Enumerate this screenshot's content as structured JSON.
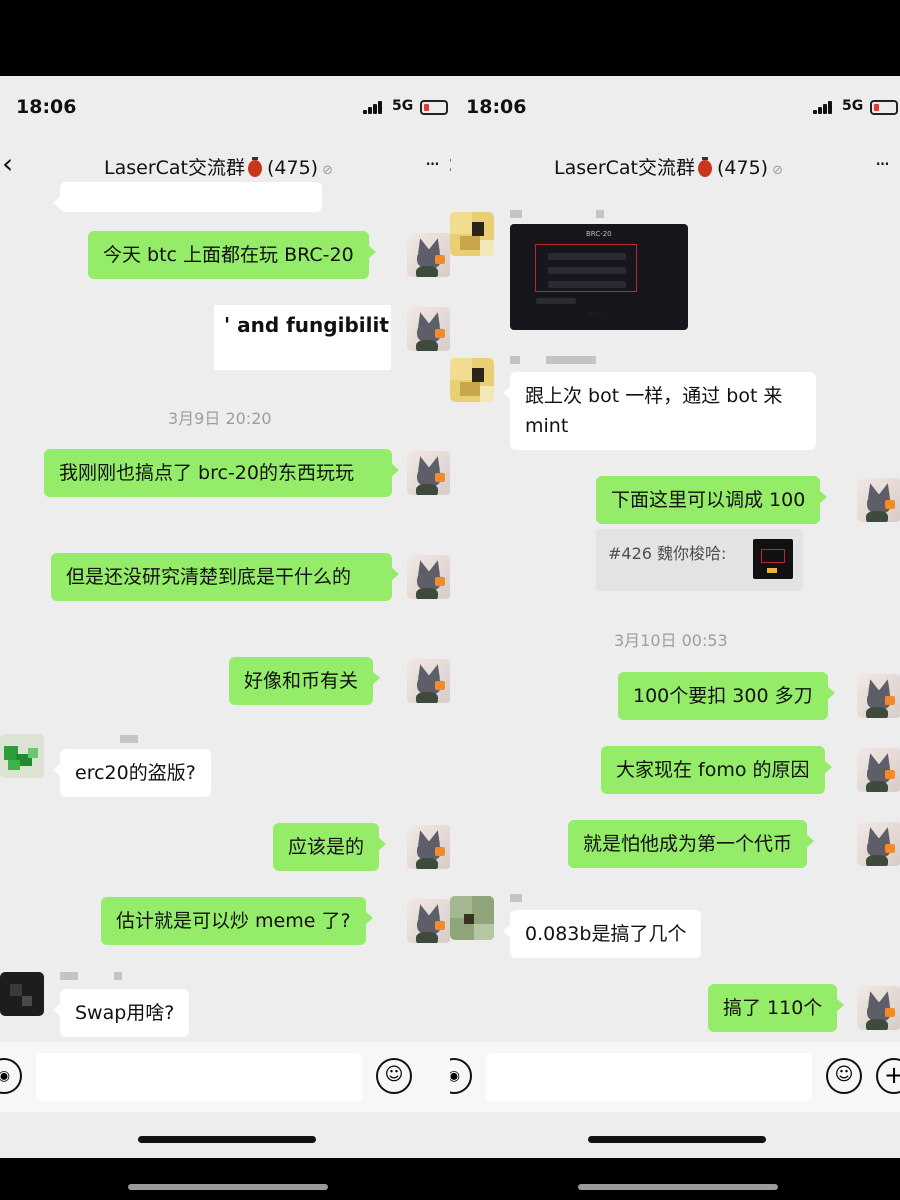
{
  "left": {
    "status": {
      "time": "18:06",
      "network": "5G"
    },
    "nav": {
      "back": "‹",
      "title": "LaserCat交流群",
      "count": "(475)",
      "mute": "⊘",
      "more": "···"
    },
    "messages": [
      {
        "text": "今天 btc 上面都在玩 BRC-20"
      },
      {
        "text": "' and fungibilit"
      },
      {
        "text": "我刚刚也搞点了 brc-20的东西玩玩"
      },
      {
        "text": "但是还没研究清楚到底是干什么的"
      },
      {
        "text": "好像和币有关"
      },
      {
        "text": "erc20的盗版?"
      },
      {
        "text": "应该是的"
      },
      {
        "text": "估计就是可以炒 meme 了?"
      },
      {
        "text": "Swap用啥?"
      }
    ],
    "timestamp": "3月9日 20:20"
  },
  "right": {
    "status": {
      "time": "18:06",
      "network": "5G"
    },
    "nav": {
      "back": "‹",
      "title": "LaserCat交流群",
      "count": "(475)",
      "mute": "⊘",
      "more": "···"
    },
    "mint_card": {
      "title": "BRC-20",
      "button": "Mint"
    },
    "messages": [
      {
        "text": "跟上次 bot 一样，通过 bot 来 mint"
      },
      {
        "text": "下面这里可以调成 100"
      },
      {
        "text": "100个要扣 300 多刀"
      },
      {
        "text": "大家现在 fomo 的原因"
      },
      {
        "text": "就是怕他成为第一个代币"
      },
      {
        "text": "0.083b是搞了几个"
      },
      {
        "text": "搞了 110个"
      }
    ],
    "quote": {
      "text": "#426 魏你梭哈:"
    },
    "timestamp": "3月10日 00:53"
  },
  "input": {
    "emoji_icon": "☺",
    "plus_icon": "+",
    "voice_icon": "◉"
  },
  "colors": {
    "sent_bubble": "#95ec69",
    "received_bubble": "#ffffff",
    "chat_bg": "#ededed",
    "lantern": "#c9361e"
  }
}
